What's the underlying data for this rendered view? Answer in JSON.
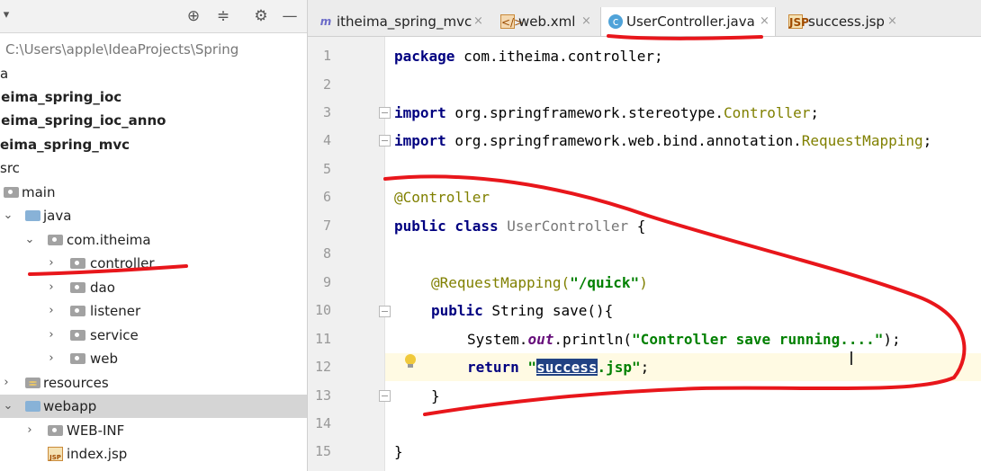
{
  "project_panel": {
    "toolbar": {
      "target_icon": "⊕",
      "collapse_icon": "≑",
      "settings_icon": "⚙",
      "hide_icon": "—"
    },
    "tree": [
      {
        "label": "C:\\Users\\apple\\IdeaProjects\\Spring",
        "style": "path"
      },
      {
        "label": "a"
      },
      {
        "label": "ieima_spring_ioc",
        "style": "bold"
      },
      {
        "label": "ieima_spring_ioc_anno",
        "style": "bold"
      },
      {
        "label": "eima_spring_mvc",
        "style": "bold"
      },
      {
        "label": "src"
      },
      {
        "label": "main"
      },
      {
        "label": "java"
      },
      {
        "label": "com.itheima"
      },
      {
        "label": "controller"
      },
      {
        "label": "dao"
      },
      {
        "label": "listener"
      },
      {
        "label": "service"
      },
      {
        "label": "web"
      },
      {
        "label": "resources"
      },
      {
        "label": "webapp"
      },
      {
        "label": "WEB-INF"
      },
      {
        "label": "index.jsp"
      }
    ]
  },
  "tabs": [
    {
      "label": "itheima_spring_mvc",
      "icon": "m-module-icon"
    },
    {
      "label": "web.xml",
      "icon": "xml-file-icon"
    },
    {
      "label": "UserController.java",
      "icon": "java-class-icon",
      "active": true
    },
    {
      "label": "success.jsp",
      "icon": "jsp-file-icon"
    }
  ],
  "tab_icons": {
    "m": "m",
    "c": "c",
    "jsp": "JSP",
    "xml": "</>"
  },
  "tab_close": "×",
  "line_numbers": [
    "1",
    "2",
    "3",
    "4",
    "5",
    "6",
    "7",
    "8",
    "9",
    "10",
    "11",
    "12",
    "13",
    "14",
    "15"
  ],
  "code": {
    "l1_kw": "package",
    "l1_rest": " com.itheima.controller;",
    "l3_kw": "import",
    "l3_pkg": " org.springframework.stereotype.",
    "l3_cls": "Controller",
    "l3_end": ";",
    "l4_kw": "import",
    "l4_pkg": " org.springframework.web.bind.annotation.",
    "l4_cls": "RequestMapping",
    "l4_end": ";",
    "l6_ann": "@Controller",
    "l7_kw": "public class",
    "l7_name": " UserController",
    "l7_end": " {",
    "l9_ann": "@RequestMapping(",
    "l9_str": "\"/quick\"",
    "l9_end": ")",
    "l10_kw": "public",
    "l10_rest": " String save(){",
    "l11_pre": "System.",
    "l11_field": "out",
    "l11_mid": ".println(",
    "l11_str": "\"Controller save running....\"",
    "l11_end": ");",
    "l12_kw": "return",
    "l12_q1": " \"",
    "l12_sel": "success",
    "l12_str": ".jsp\"",
    "l12_end": ";",
    "l13": "}",
    "l15": "}"
  },
  "colors": {
    "keyword": "#000080",
    "annotation": "#808000",
    "string": "#008000",
    "selection": "#214283",
    "current_line": "#fffae3",
    "annotation_ink": "#e8161b"
  },
  "text_cursor": "I"
}
